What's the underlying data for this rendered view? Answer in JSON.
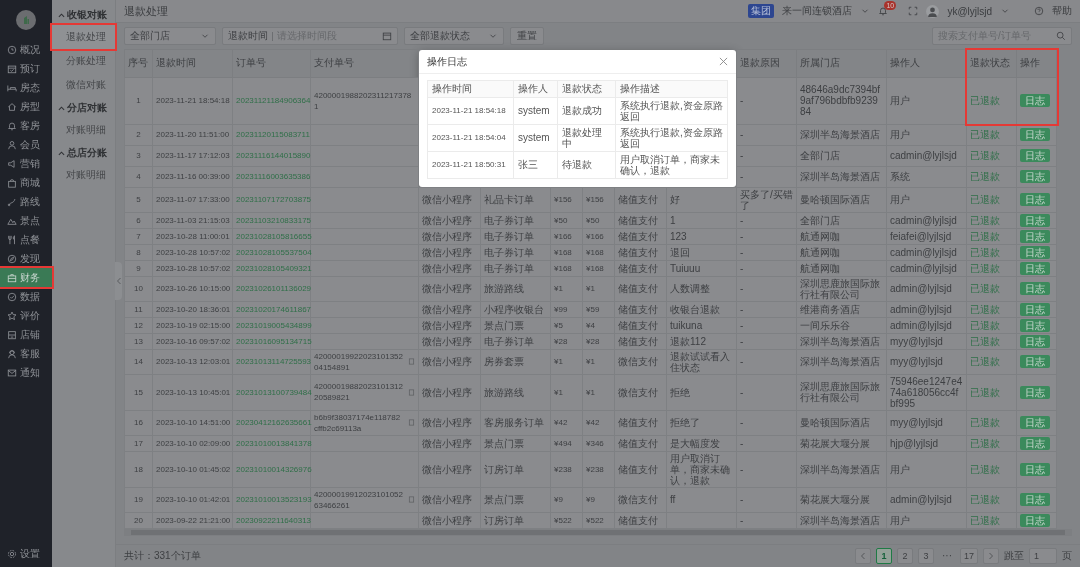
{
  "sidebar": {
    "items": [
      {
        "label": "概况",
        "selected": false,
        "highlighted": false
      },
      {
        "label": "预订",
        "selected": false,
        "highlighted": false
      },
      {
        "label": "房态",
        "selected": false,
        "highlighted": false
      },
      {
        "label": "房型",
        "selected": false,
        "highlighted": false
      },
      {
        "label": "客房",
        "selected": false,
        "highlighted": false
      },
      {
        "label": "会员",
        "selected": false,
        "highlighted": false
      },
      {
        "label": "营销",
        "selected": false,
        "highlighted": false
      },
      {
        "label": "商城",
        "selected": false,
        "highlighted": false
      },
      {
        "label": "路线",
        "selected": false,
        "highlighted": false
      },
      {
        "label": "景点",
        "selected": false,
        "highlighted": false
      },
      {
        "label": "点餐",
        "selected": false,
        "highlighted": false
      },
      {
        "label": "发现",
        "selected": false,
        "highlighted": false
      },
      {
        "label": "财务",
        "selected": true,
        "highlighted": true
      },
      {
        "label": "数据",
        "selected": false,
        "highlighted": false
      },
      {
        "label": "评价",
        "selected": false,
        "highlighted": false
      },
      {
        "label": "店铺",
        "selected": false,
        "highlighted": false
      },
      {
        "label": "客服",
        "selected": false,
        "highlighted": false
      },
      {
        "label": "通知",
        "selected": false,
        "highlighted": false
      }
    ],
    "footer_item": {
      "label": "设置"
    }
  },
  "submenu": {
    "groups": [
      {
        "title": "收银对账",
        "expanded": true,
        "items": [
          {
            "label": "退款处理",
            "selected": true,
            "highlighted": true
          },
          {
            "label": "分账处理",
            "selected": false,
            "highlighted": false
          },
          {
            "label": "微信对账",
            "selected": false,
            "highlighted": false
          }
        ]
      },
      {
        "title": "分店对账",
        "expanded": true,
        "items": [
          {
            "label": "对账明细",
            "selected": false,
            "highlighted": false
          }
        ]
      },
      {
        "title": "总店分账",
        "expanded": true,
        "items": [
          {
            "label": "对账明细",
            "selected": false,
            "highlighted": false
          }
        ]
      }
    ]
  },
  "header": {
    "title": "退款处理",
    "org_badge": "集团",
    "org_name": "来一间连锁酒店",
    "notification_count": "10",
    "user": "yk@lyjlsjd",
    "help": "帮助"
  },
  "filters": {
    "store_select": "全部门店",
    "date_label": "退款时间",
    "date_placeholder": "请选择时间段",
    "status_select": "全部退款状态",
    "reset": "重置",
    "search_placeholder": "搜索支付单号/订单号"
  },
  "table": {
    "columns": {
      "no": {
        "label": "序号",
        "highlighted": false
      },
      "refund_time": {
        "label": "退款时间",
        "highlighted": false
      },
      "order_no": {
        "label": "订单号",
        "highlighted": false
      },
      "pay_no": {
        "label": "支付单号",
        "highlighted": false
      },
      "reason": {
        "label": "退款原因",
        "highlighted": false
      },
      "store": {
        "label": "所属门店",
        "highlighted": false
      },
      "operator": {
        "label": "操作人",
        "highlighted": false
      },
      "status": {
        "label": "退款状态",
        "highlighted": true
      },
      "action": {
        "label": "操作",
        "highlighted": true
      }
    },
    "rows": [
      {
        "no": "1",
        "refund_time": "2023-11-21 18:54:18",
        "order_no": "20231121184906364",
        "pay_no": "42000019882023112173781",
        "reason": "-",
        "store": "48646a9dc7394bf9af796bdbfb923984",
        "operator": "用户",
        "status": "已退款",
        "action": "日志"
      },
      {
        "no": "2",
        "refund_time": "2023-11-20 11:51:00",
        "order_no": "20231120115083711",
        "reason": "-",
        "store": "深圳半岛海景酒店",
        "operator": "用户",
        "status": "已退款",
        "action": "日志"
      },
      {
        "no": "3",
        "refund_time": "2023-11-17 17:12:03",
        "order_no": "20231116144015890",
        "reason": "-",
        "store": "全部门店",
        "operator": "cadmin@lyjlsjd",
        "status": "已退款",
        "action": "日志"
      },
      {
        "no": "4",
        "refund_time": "2023-11-16 00:39:00",
        "order_no": "20231116003635386",
        "reason": "-",
        "store": "深圳半岛海景酒店",
        "operator": "系统",
        "status": "已退款",
        "action": "日志"
      },
      {
        "no": "5",
        "refund_time": "2023-11-07 17:33:00",
        "order_no": "20231107172703875",
        "column_5": "微信小程序",
        "column_6": "礼品卡订单",
        "column_7": "¥156",
        "column_8": "¥156",
        "column_9": "储值支付",
        "column_10": "好",
        "reason": "买多了/买错了",
        "store": "曼哈顿国际酒店",
        "operator": "用户",
        "status": "已退款",
        "action": "日志"
      },
      {
        "no": "6",
        "refund_time": "2023-11-03 21:15:03",
        "order_no": "20231103210833175",
        "column_5": "微信小程序",
        "column_6": "电子券订单",
        "column_7": "¥50",
        "column_8": "¥50",
        "column_9": "储值支付",
        "column_10": "1",
        "reason": "-",
        "store": "全部门店",
        "operator": "cadmin@lyjlsjd",
        "status": "已退款",
        "action": "日志"
      },
      {
        "no": "7",
        "refund_time": "2023-10-28 11:00:01",
        "order_no": "20231028105816655",
        "column_5": "微信小程序",
        "column_6": "电子券订单",
        "column_7": "¥166",
        "column_8": "¥166",
        "column_9": "储值支付",
        "column_10": "123",
        "reason": "-",
        "store": "航通网咖",
        "operator": "feiafei@lyjlsjd",
        "status": "已退款",
        "action": "日志"
      },
      {
        "no": "8",
        "refund_time": "2023-10-28 10:57:02",
        "order_no": "20231028105537504",
        "column_5": "微信小程序",
        "column_6": "电子券订单",
        "column_7": "¥168",
        "column_8": "¥168",
        "column_9": "储值支付",
        "column_10": "退回",
        "reason": "-",
        "store": "航通网咖",
        "operator": "cadmin@lyjlsjd",
        "status": "已退款",
        "action": "日志"
      },
      {
        "no": "9",
        "refund_time": "2023-10-28 10:57:02",
        "order_no": "20231028105409321",
        "column_5": "微信小程序",
        "column_6": "电子券订单",
        "column_7": "¥168",
        "column_8": "¥168",
        "column_9": "储值支付",
        "column_10": "Tuiuuu",
        "reason": "-",
        "store": "航通网咖",
        "operator": "cadmin@lyjlsjd",
        "status": "已退款",
        "action": "日志"
      },
      {
        "no": "10",
        "refund_time": "2023-10-26 10:15:00",
        "order_no": "20231026101136029",
        "column_5": "微信小程序",
        "column_6": "旅游路线",
        "column_7": "¥1",
        "column_8": "¥1",
        "column_9": "储值支付",
        "column_10": "人数调整",
        "reason": "-",
        "store": "深圳思鹿旅国际旅行社有限公司",
        "operator": "admin@lyjlsjd",
        "status": "已退款",
        "action": "日志"
      },
      {
        "no": "11",
        "refund_time": "2023-10-20 18:36:01",
        "order_no": "20231020174611867",
        "column_5": "微信小程序",
        "column_6": "小程序收银台",
        "column_7": "¥99",
        "column_8": "¥59",
        "column_9": "储值支付",
        "column_10": "收银台退款",
        "reason": "-",
        "store": "维港商务酒店",
        "operator": "admin@lyjlsjd",
        "status": "已退款",
        "action": "日志"
      },
      {
        "no": "12",
        "refund_time": "2023-10-19 02:15:00",
        "order_no": "20231019005434899",
        "column_5": "微信小程序",
        "column_6": "景点门票",
        "column_7": "¥5",
        "column_8": "¥4",
        "column_9": "储值支付",
        "column_10": "tuikuna",
        "reason": "-",
        "store": "一间乐乐谷",
        "operator": "admin@lyjlsjd",
        "status": "已退款",
        "action": "日志"
      },
      {
        "no": "13",
        "refund_time": "2023-10-16 09:57:02",
        "order_no": "20231016095134715",
        "column_5": "微信小程序",
        "column_6": "电子券订单",
        "column_7": "¥28",
        "column_8": "¥28",
        "column_9": "储值支付",
        "column_10": "退款112",
        "reason": "-",
        "store": "深圳半岛海景酒店",
        "operator": "myy@lyjlsjd",
        "status": "已退款",
        "action": "日志"
      },
      {
        "no": "14",
        "refund_time": "2023-10-13 12:03:01",
        "order_no": "20231013114725593",
        "pay_no": "4200001992202310135204154891",
        "column_5": "微信小程序",
        "column_6": "房券套票",
        "column_7": "¥1",
        "column_8": "¥1",
        "column_9": "微信支付",
        "column_10": "退款试试看入住状态",
        "reason": "-",
        "store": "深圳半岛海景酒店",
        "operator": "myy@lyjlsjd",
        "status": "已退款",
        "action": "日志"
      },
      {
        "no": "15",
        "refund_time": "2023-10-13 10:45:01",
        "order_no": "20231013100739484",
        "pay_no": "4200001988202310131220589821",
        "column_5": "微信小程序",
        "column_6": "旅游路线",
        "column_7": "¥1",
        "column_8": "¥1",
        "column_9": "微信支付",
        "column_10": "拒绝",
        "reason": "-",
        "store": "深圳思鹿旅国际旅行社有限公司",
        "operator": "75946ee1247e474a618056cc4fbf995",
        "status": "已退款",
        "action": "日志"
      },
      {
        "no": "16",
        "refund_time": "2023-10-10 14:51:00",
        "order_no": "20230412162635661",
        "pay_no": "b6b9f38037174e118782cffb2c69113a",
        "column_5": "微信小程序",
        "column_6": "客房服务订单",
        "column_7": "¥42",
        "column_8": "¥42",
        "column_9": "储值支付",
        "column_10": "拒绝了",
        "reason": "-",
        "store": "曼哈顿国际酒店",
        "operator": "myy@lyjlsjd",
        "status": "已退款",
        "action": "日志"
      },
      {
        "no": "17",
        "refund_time": "2023-10-10 02:09:00",
        "order_no": "20231010013841378",
        "column_5": "微信小程序",
        "column_6": "景点门票",
        "column_7": "¥494",
        "column_8": "¥346",
        "column_9": "储值支付",
        "column_10": "是大幅度发",
        "reason": "-",
        "store": "菊花展大堰分展",
        "operator": "hjp@lyjlsjd",
        "status": "已退款",
        "action": "日志"
      },
      {
        "no": "18",
        "refund_time": "2023-10-10 01:45:02",
        "order_no": "20231010014326976",
        "column_5": "微信小程序",
        "column_6": "订房订单",
        "column_7": "¥238",
        "column_8": "¥238",
        "column_9": "储值支付",
        "column_10": "用户取消订单，商家未确认，退款",
        "reason": "-",
        "store": "深圳半岛海景酒店",
        "operator": "用户",
        "status": "已退款",
        "action": "日志"
      },
      {
        "no": "19",
        "refund_time": "2023-10-10 01:42:01",
        "order_no": "20231010013523193",
        "pay_no": "4200001991202310105263466261",
        "column_5": "微信小程序",
        "column_6": "景点门票",
        "column_7": "¥9",
        "column_8": "¥9",
        "column_9": "微信支付",
        "column_10": "ff",
        "reason": "-",
        "store": "菊花展大堰分展",
        "operator": "admin@lyjlsjd",
        "status": "已退款",
        "action": "日志"
      },
      {
        "no": "20",
        "refund_time": "2023-09-22 21:21:00",
        "order_no": "20230922211640313",
        "column_5": "微信小程序",
        "column_6": "订房订单",
        "column_7": "¥522",
        "column_8": "¥522",
        "column_9": "储值支付",
        "reason": "-",
        "store": "深圳半岛海景酒店",
        "operator": "用户",
        "status": "已退款",
        "action": "日志"
      }
    ]
  },
  "dialog": {
    "title": "操作日志",
    "columns": [
      "操作时间",
      "操作人",
      "退款状态",
      "操作描述"
    ],
    "rows": [
      [
        "2023-11-21 18:54:18",
        "system",
        "退款成功",
        "系统执行退款,资金原路返回"
      ],
      [
        "2023-11-21 18:54:04",
        "system",
        "退款处理中",
        "系统执行退款,资金原路返回"
      ],
      [
        "2023-11-21 18:50:31",
        "张三",
        "待退款",
        "用户取消订单，商家未确认，退款"
      ]
    ]
  },
  "footer": {
    "total": "共计：331个订单",
    "pages": [
      {
        "kind": "page",
        "label": "1",
        "selected": true
      },
      {
        "kind": "page",
        "label": "2",
        "selected": false
      },
      {
        "kind": "page",
        "label": "3",
        "selected": false
      },
      {
        "kind": "ellipsis",
        "label": "···",
        "selected": false
      },
      {
        "kind": "page",
        "label": "17",
        "selected": false
      }
    ],
    "jump_label": "跳至",
    "jump_value": "1",
    "jump_suffix": "页"
  }
}
